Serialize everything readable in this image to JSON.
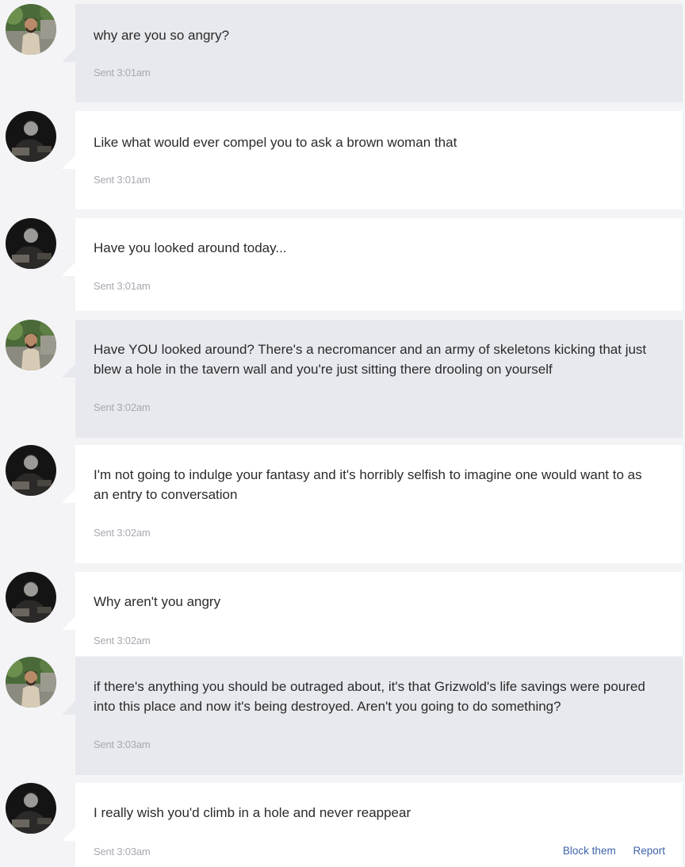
{
  "colors": {
    "page_background": "#f4f4f6",
    "received_bubble": "#e8e9ee",
    "sent_bubble": "#ffffff",
    "timestamp_text": "#a7a9b0",
    "action_link": "#3f63a8"
  },
  "messages": [
    {
      "side": "theirs",
      "avatar": "bearded-man-outdoor-avatar",
      "text": "why are you so angry?",
      "time": "Sent 3:01am"
    },
    {
      "side": "mine",
      "avatar": "dark-silhouette-avatar",
      "text": "Like what would ever compel you to ask a brown woman that",
      "time": "Sent 3:01am"
    },
    {
      "side": "mine",
      "avatar": "dark-silhouette-avatar",
      "text": "Have you looked around today...",
      "time": "Sent 3:01am"
    },
    {
      "side": "theirs",
      "avatar": "bearded-man-outdoor-avatar",
      "text": "Have YOU looked around? There's a necromancer and an army of skeletons kicking that just blew a hole in the tavern wall and you're just sitting there drooling on yourself",
      "time": "Sent 3:02am"
    },
    {
      "side": "mine",
      "avatar": "dark-silhouette-avatar",
      "text": "I'm not going to indulge your fantasy and it's horribly selfish to imagine one would want to as an entry to conversation",
      "time": "Sent 3:02am"
    },
    {
      "side": "mine",
      "avatar": "dark-silhouette-avatar",
      "text": "Why aren't you angry",
      "time": "Sent 3:02am"
    },
    {
      "side": "theirs",
      "avatar": "bearded-man-outdoor-avatar",
      "text": "if there's anything you should be outraged about, it's that Grizwold's life savings were poured into this place and now it's being destroyed. Aren't you going to do something?",
      "time": "Sent 3:03am"
    },
    {
      "side": "mine",
      "avatar": "dark-silhouette-avatar",
      "text": "I really wish you'd climb in a hole and never reappear",
      "time": "Sent 3:03am"
    }
  ],
  "actions": {
    "block_label": "Block them",
    "report_label": "Report"
  }
}
